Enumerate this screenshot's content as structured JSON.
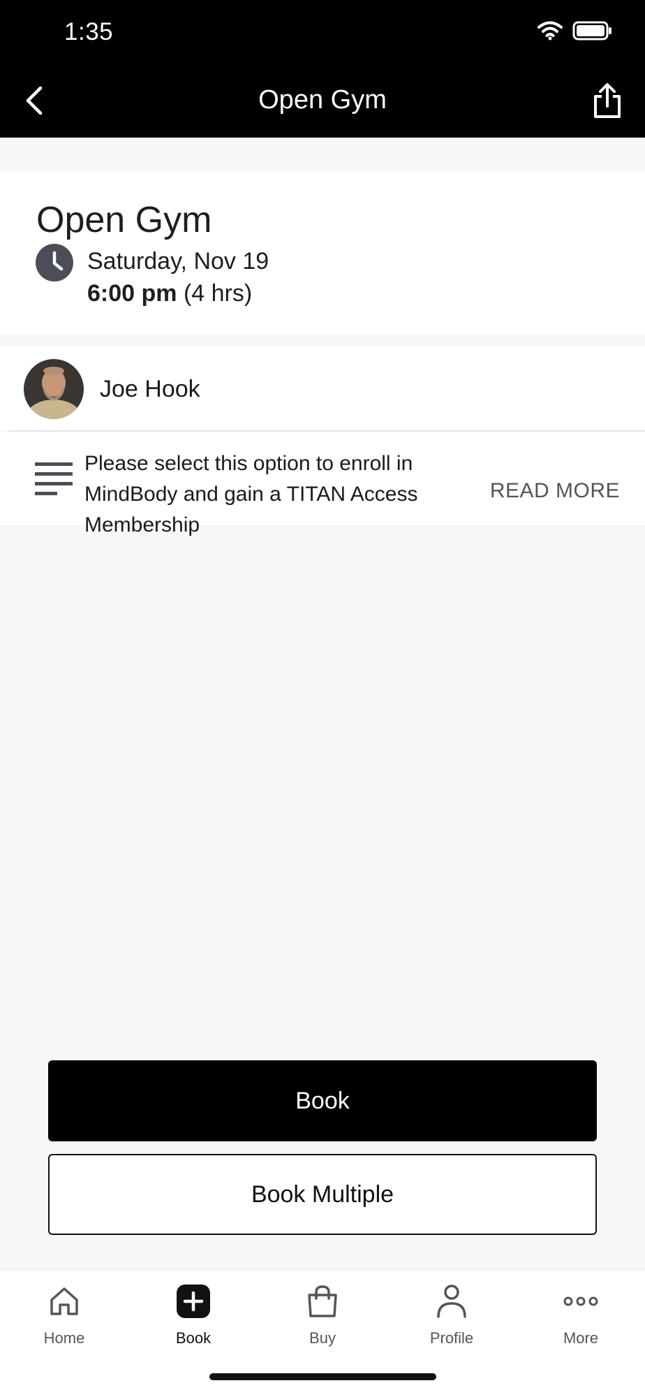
{
  "status": {
    "time": "1:35"
  },
  "header": {
    "title": "Open Gym",
    "back_icon": "chevron-left-icon",
    "share_icon": "share-icon"
  },
  "class_info": {
    "title": "Open Gym",
    "date": "Saturday, Nov 19",
    "start_time": "6:00 pm",
    "duration": "(4 hrs)"
  },
  "instructor": {
    "name": "Joe Hook"
  },
  "description": {
    "text": "Please select this option to enroll in MindBody and gain a TITAN Access Membership",
    "read_more": "READ MORE"
  },
  "actions": {
    "book": "Book",
    "book_multiple": "Book Multiple"
  },
  "tabs": [
    {
      "label": "Home",
      "icon": "home-icon"
    },
    {
      "label": "Book",
      "icon": "plus-square-icon",
      "active": true
    },
    {
      "label": "Buy",
      "icon": "shopping-bag-icon"
    },
    {
      "label": "Profile",
      "icon": "person-icon"
    },
    {
      "label": "More",
      "icon": "more-dots-icon"
    }
  ],
  "colors": {
    "header_bg": "#000000",
    "page_bg": "#f6f7f9",
    "primary_button": "#000000",
    "icon_gray": "#4b4e57"
  }
}
